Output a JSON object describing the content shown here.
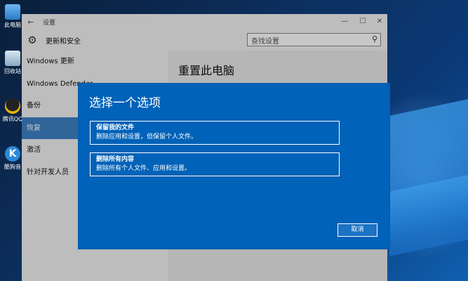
{
  "desktop": {
    "icons": [
      {
        "label": "此电脑"
      },
      {
        "label": "回收站"
      },
      {
        "label": "腾讯QQ"
      },
      {
        "label": "酷狗音"
      }
    ]
  },
  "window": {
    "title": "设置",
    "section_title": "更新和安全",
    "search_placeholder": "查找设置",
    "sidebar": [
      {
        "label": "Windows 更新",
        "active": false
      },
      {
        "label": "Windows Defender",
        "active": false
      },
      {
        "label": "备份",
        "active": false
      },
      {
        "label": "恢复",
        "active": true
      },
      {
        "label": "激活",
        "active": false
      },
      {
        "label": "针对开发人员",
        "active": false
      }
    ],
    "main_title": "重置此电脑"
  },
  "dialog": {
    "title": "选择一个选项",
    "options": [
      {
        "heading": "保留我的文件",
        "desc": "删除应用和设置，但保留个人文件。"
      },
      {
        "heading": "删除所有内容",
        "desc": "删除所有个人文件、应用和设置。"
      }
    ],
    "cancel_label": "取消"
  },
  "colors": {
    "dialog_bg": "#0062b8",
    "sidebar_active": "#3e82c6"
  }
}
